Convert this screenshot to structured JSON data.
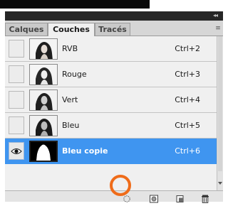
{
  "panel": {
    "collapse_glyph": "◂◂",
    "panel_menu_glyph": "≡",
    "tabs": [
      {
        "label": "Calques",
        "active": false
      },
      {
        "label": "Couches",
        "active": true
      },
      {
        "label": "Tracés",
        "active": false
      }
    ]
  },
  "channels": [
    {
      "name": "RVB",
      "shortcut": "Ctrl+2",
      "visible": false,
      "selected": false
    },
    {
      "name": "Rouge",
      "shortcut": "Ctrl+3",
      "visible": false,
      "selected": false
    },
    {
      "name": "Vert",
      "shortcut": "Ctrl+4",
      "visible": false,
      "selected": false
    },
    {
      "name": "Bleu",
      "shortcut": "Ctrl+5",
      "visible": false,
      "selected": false
    },
    {
      "name": "Bleu copie",
      "shortcut": "Ctrl+6",
      "visible": true,
      "selected": true
    }
  ],
  "footer_buttons": [
    {
      "icon": "load-selection-icon"
    },
    {
      "icon": "save-selection-icon"
    },
    {
      "icon": "new-channel-icon"
    },
    {
      "icon": "trash-icon"
    }
  ],
  "colors": {
    "selection": "#3f95f0",
    "highlight_ring": "#ef6c1a"
  }
}
